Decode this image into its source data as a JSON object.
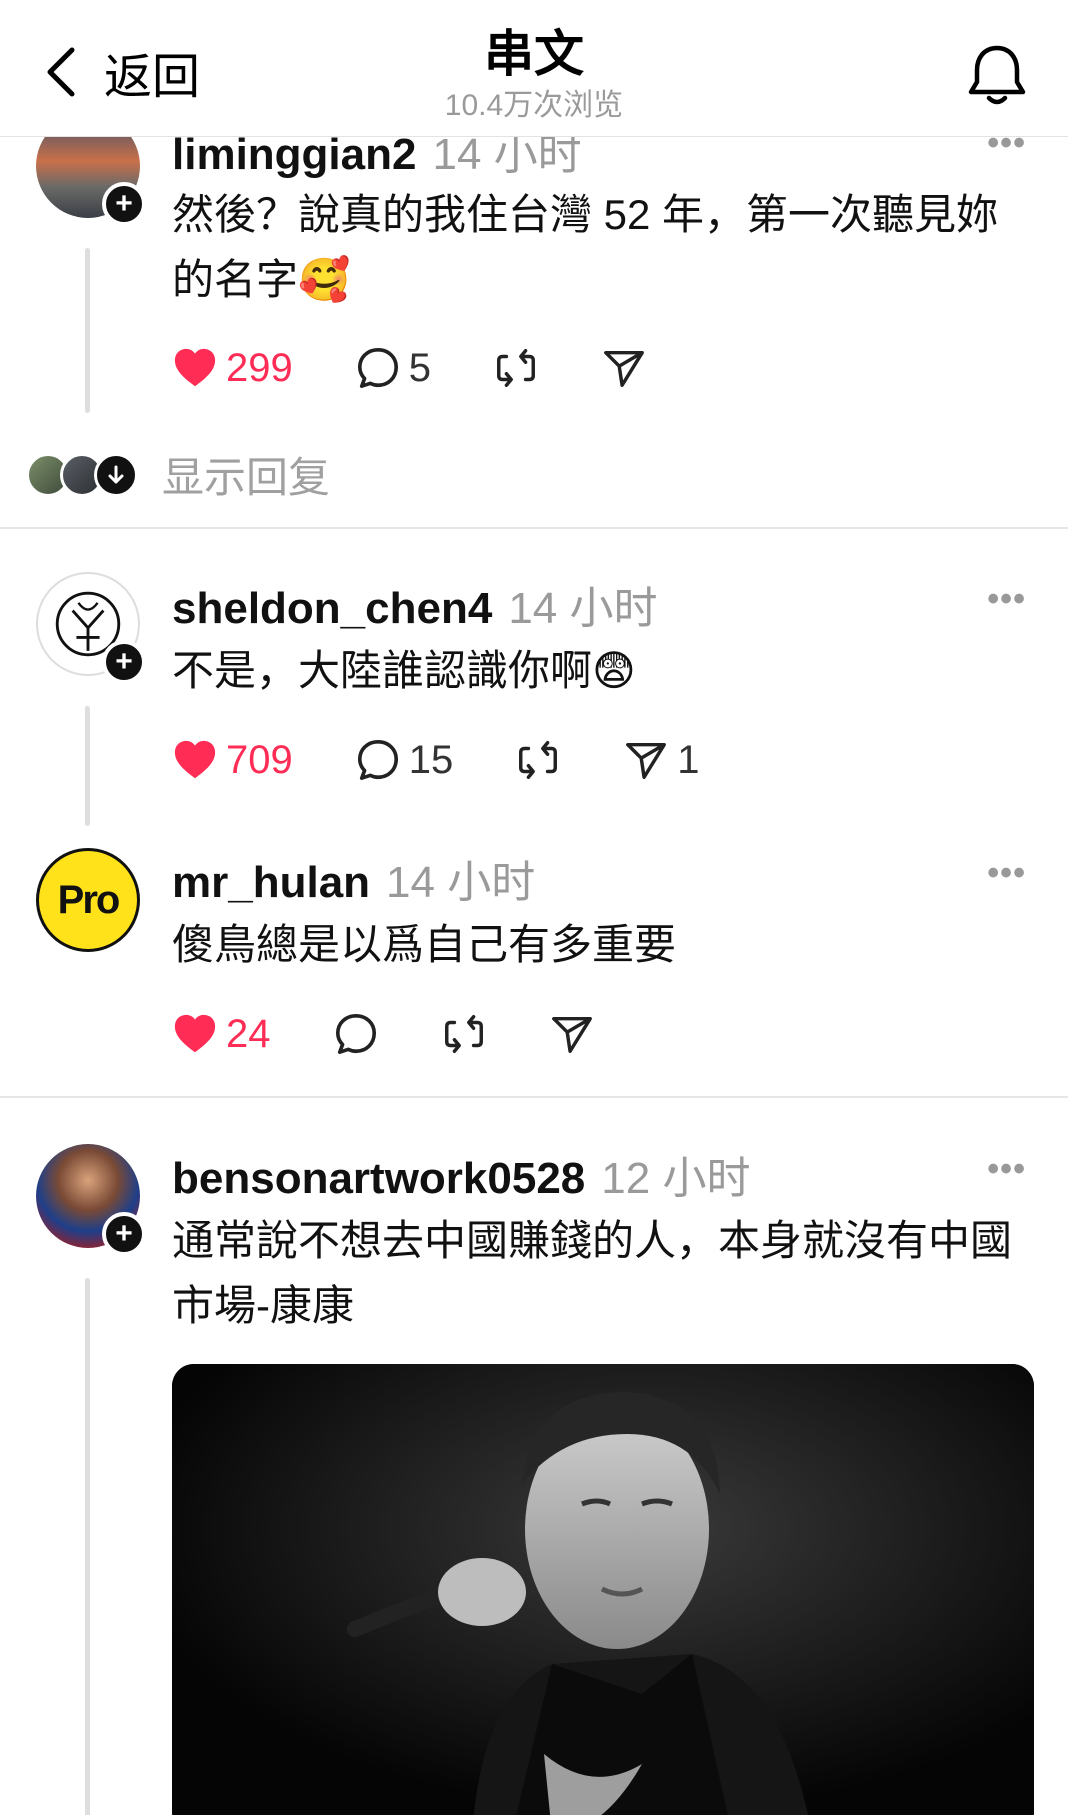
{
  "header": {
    "back_label": "返回",
    "title": "串文",
    "views": "10.4万次浏览"
  },
  "posts": [
    {
      "username": "liminggian2",
      "time": "14 小时",
      "text": "然後？說真的我住台灣 52 年，第一次聽見妳的名字🥰",
      "likes": "299",
      "replies": "5",
      "shares": ""
    },
    {
      "username": "sheldon_chen4",
      "time": "14 小时",
      "text": "不是，大陸誰認識你啊😨",
      "likes": "709",
      "replies": "15",
      "shares": "1"
    },
    {
      "username": "mr_hulan",
      "time": "14 小时",
      "text": "傻鳥總是以爲自己有多重要",
      "likes": "24",
      "replies": "",
      "shares": "",
      "avatar_text": "Pro"
    },
    {
      "username": "bensonartwork0528",
      "time": "12 小时",
      "text": "通常說不想去中國賺錢的人，本身就沒有中國市場-康康"
    }
  ],
  "show_replies_label": "显示回复",
  "colors": {
    "like_red": "#ff2d55",
    "muted_gray": "#9a9a9a",
    "pro_yellow": "#ffe21a"
  },
  "icons": [
    "chevron-left-icon",
    "bell-icon",
    "heart-icon",
    "comment-icon",
    "repost-icon",
    "send-icon",
    "more-icon",
    "plus-icon",
    "arrow-down-icon"
  ]
}
